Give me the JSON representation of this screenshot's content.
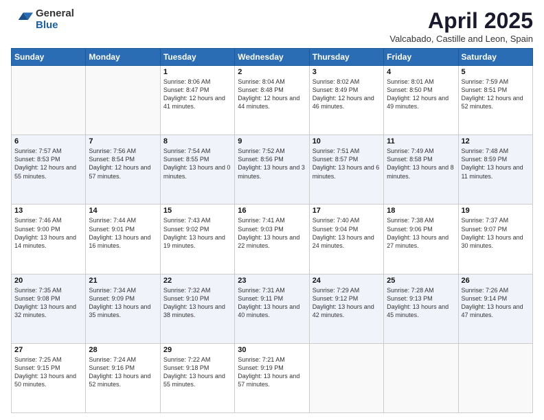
{
  "header": {
    "logo_general": "General",
    "logo_blue": "Blue",
    "title": "April 2025",
    "subtitle": "Valcabado, Castille and Leon, Spain"
  },
  "weekdays": [
    "Sunday",
    "Monday",
    "Tuesday",
    "Wednesday",
    "Thursday",
    "Friday",
    "Saturday"
  ],
  "weeks": [
    [
      {
        "day": "",
        "info": ""
      },
      {
        "day": "",
        "info": ""
      },
      {
        "day": "1",
        "info": "Sunrise: 8:06 AM\nSunset: 8:47 PM\nDaylight: 12 hours and 41 minutes."
      },
      {
        "day": "2",
        "info": "Sunrise: 8:04 AM\nSunset: 8:48 PM\nDaylight: 12 hours and 44 minutes."
      },
      {
        "day": "3",
        "info": "Sunrise: 8:02 AM\nSunset: 8:49 PM\nDaylight: 12 hours and 46 minutes."
      },
      {
        "day": "4",
        "info": "Sunrise: 8:01 AM\nSunset: 8:50 PM\nDaylight: 12 hours and 49 minutes."
      },
      {
        "day": "5",
        "info": "Sunrise: 7:59 AM\nSunset: 8:51 PM\nDaylight: 12 hours and 52 minutes."
      }
    ],
    [
      {
        "day": "6",
        "info": "Sunrise: 7:57 AM\nSunset: 8:53 PM\nDaylight: 12 hours and 55 minutes."
      },
      {
        "day": "7",
        "info": "Sunrise: 7:56 AM\nSunset: 8:54 PM\nDaylight: 12 hours and 57 minutes."
      },
      {
        "day": "8",
        "info": "Sunrise: 7:54 AM\nSunset: 8:55 PM\nDaylight: 13 hours and 0 minutes."
      },
      {
        "day": "9",
        "info": "Sunrise: 7:52 AM\nSunset: 8:56 PM\nDaylight: 13 hours and 3 minutes."
      },
      {
        "day": "10",
        "info": "Sunrise: 7:51 AM\nSunset: 8:57 PM\nDaylight: 13 hours and 6 minutes."
      },
      {
        "day": "11",
        "info": "Sunrise: 7:49 AM\nSunset: 8:58 PM\nDaylight: 13 hours and 8 minutes."
      },
      {
        "day": "12",
        "info": "Sunrise: 7:48 AM\nSunset: 8:59 PM\nDaylight: 13 hours and 11 minutes."
      }
    ],
    [
      {
        "day": "13",
        "info": "Sunrise: 7:46 AM\nSunset: 9:00 PM\nDaylight: 13 hours and 14 minutes."
      },
      {
        "day": "14",
        "info": "Sunrise: 7:44 AM\nSunset: 9:01 PM\nDaylight: 13 hours and 16 minutes."
      },
      {
        "day": "15",
        "info": "Sunrise: 7:43 AM\nSunset: 9:02 PM\nDaylight: 13 hours and 19 minutes."
      },
      {
        "day": "16",
        "info": "Sunrise: 7:41 AM\nSunset: 9:03 PM\nDaylight: 13 hours and 22 minutes."
      },
      {
        "day": "17",
        "info": "Sunrise: 7:40 AM\nSunset: 9:04 PM\nDaylight: 13 hours and 24 minutes."
      },
      {
        "day": "18",
        "info": "Sunrise: 7:38 AM\nSunset: 9:06 PM\nDaylight: 13 hours and 27 minutes."
      },
      {
        "day": "19",
        "info": "Sunrise: 7:37 AM\nSunset: 9:07 PM\nDaylight: 13 hours and 30 minutes."
      }
    ],
    [
      {
        "day": "20",
        "info": "Sunrise: 7:35 AM\nSunset: 9:08 PM\nDaylight: 13 hours and 32 minutes."
      },
      {
        "day": "21",
        "info": "Sunrise: 7:34 AM\nSunset: 9:09 PM\nDaylight: 13 hours and 35 minutes."
      },
      {
        "day": "22",
        "info": "Sunrise: 7:32 AM\nSunset: 9:10 PM\nDaylight: 13 hours and 38 minutes."
      },
      {
        "day": "23",
        "info": "Sunrise: 7:31 AM\nSunset: 9:11 PM\nDaylight: 13 hours and 40 minutes."
      },
      {
        "day": "24",
        "info": "Sunrise: 7:29 AM\nSunset: 9:12 PM\nDaylight: 13 hours and 42 minutes."
      },
      {
        "day": "25",
        "info": "Sunrise: 7:28 AM\nSunset: 9:13 PM\nDaylight: 13 hours and 45 minutes."
      },
      {
        "day": "26",
        "info": "Sunrise: 7:26 AM\nSunset: 9:14 PM\nDaylight: 13 hours and 47 minutes."
      }
    ],
    [
      {
        "day": "27",
        "info": "Sunrise: 7:25 AM\nSunset: 9:15 PM\nDaylight: 13 hours and 50 minutes."
      },
      {
        "day": "28",
        "info": "Sunrise: 7:24 AM\nSunset: 9:16 PM\nDaylight: 13 hours and 52 minutes."
      },
      {
        "day": "29",
        "info": "Sunrise: 7:22 AM\nSunset: 9:18 PM\nDaylight: 13 hours and 55 minutes."
      },
      {
        "day": "30",
        "info": "Sunrise: 7:21 AM\nSunset: 9:19 PM\nDaylight: 13 hours and 57 minutes."
      },
      {
        "day": "",
        "info": ""
      },
      {
        "day": "",
        "info": ""
      },
      {
        "day": "",
        "info": ""
      }
    ]
  ]
}
